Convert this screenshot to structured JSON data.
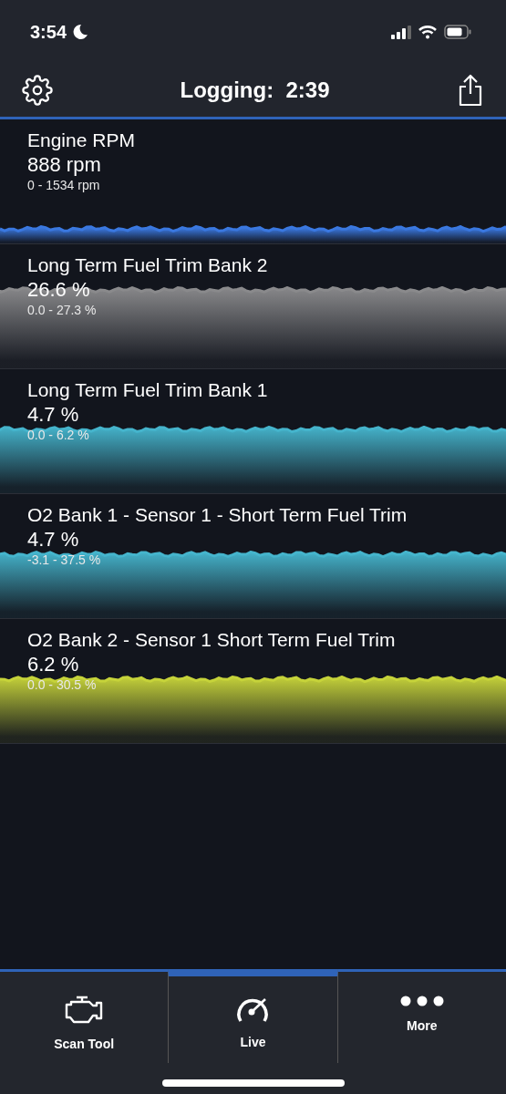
{
  "status_bar": {
    "time": "3:54"
  },
  "header": {
    "title": "Logging:  2:39"
  },
  "sensors": [
    {
      "name": "Engine RPM",
      "value": "888 rpm",
      "range": "0 - 1534 rpm",
      "color": "#3a78e0"
    },
    {
      "name": "Long Term Fuel Trim Bank 2",
      "value": "26.6 %",
      "range": "0.0 - 27.3 %",
      "color": "#8a8a8c"
    },
    {
      "name": "Long Term Fuel Trim Bank 1",
      "value": "4.7 %",
      "range": "0.0 - 6.2 %",
      "color": "#45b4cc"
    },
    {
      "name": "O2 Bank 1 - Sensor 1 - Short Term Fuel Trim",
      "value": "4.7 %",
      "range": "-3.1 - 37.5 %",
      "color": "#45b4cc"
    },
    {
      "name": "O2 Bank 2 - Sensor 1 Short Term Fuel Trim",
      "value": "6.2 %",
      "range": "0.0 - 30.5 %",
      "color": "#c6d33a"
    }
  ],
  "tabs": [
    {
      "label": "Scan Tool",
      "kind": "engine",
      "selected": false
    },
    {
      "label": "Live",
      "kind": "gauge",
      "selected": true
    },
    {
      "label": "More",
      "kind": "dots",
      "selected": false
    }
  ]
}
